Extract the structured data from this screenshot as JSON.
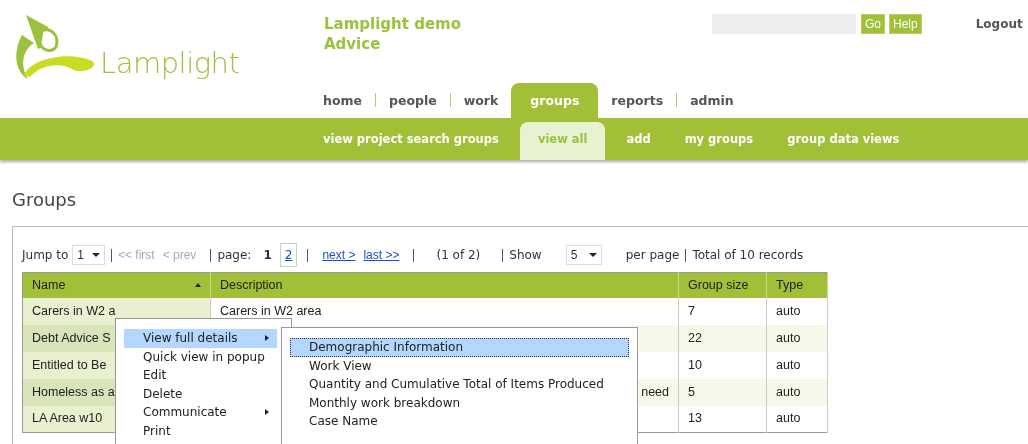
{
  "header": {
    "title_lines": [
      "Lamplight demo",
      "Advice"
    ],
    "logo_text": "Lamplight",
    "search_buttons": [
      "Go",
      "Help"
    ],
    "logout": "Logout"
  },
  "main_nav": [
    {
      "label": "home",
      "selected": false
    },
    {
      "label": "people",
      "selected": false
    },
    {
      "label": "work",
      "selected": false
    },
    {
      "label": "groups",
      "selected": true
    },
    {
      "label": "reports",
      "selected": false
    },
    {
      "label": "admin",
      "selected": false
    }
  ],
  "sub_nav": [
    {
      "label": "view project search groups",
      "selected": false
    },
    {
      "label": "view all",
      "selected": true
    },
    {
      "label": "add",
      "selected": false
    },
    {
      "label": "my groups",
      "selected": false
    },
    {
      "label": "group data views",
      "selected": false
    }
  ],
  "page_title": "Groups",
  "pager": {
    "jump_label": "Jump to",
    "jump_value": "1",
    "first": "<< first",
    "prev": "< prev",
    "page_label": "page:",
    "pages": [
      {
        "label": "1",
        "selected": true
      },
      {
        "label": "2",
        "selected": false
      }
    ],
    "next": "next >",
    "last": "last >>",
    "count": "(1 of 2)",
    "show_label": "Show",
    "show_value": "5",
    "per_page": "per page",
    "total": "Total of 10 records"
  },
  "table": {
    "columns": [
      {
        "label": "Name",
        "sorted": true
      },
      {
        "label": "Description",
        "sorted": false
      },
      {
        "label": "Group size",
        "sorted": false
      },
      {
        "label": "Type",
        "sorted": false
      }
    ],
    "rows": [
      {
        "cells": [
          "Carers in W2 a",
          "Carers in W2 area",
          "7",
          "auto"
        ]
      },
      {
        "cells": [
          "Debt Advice S",
          "",
          "22",
          "auto"
        ]
      },
      {
        "cells": [
          "Entitled to Be",
          "",
          "10",
          "auto"
        ]
      },
      {
        "cells": [
          "Homeless as a",
          "need",
          "5",
          "auto"
        ]
      },
      {
        "cells": [
          "LA Area w10",
          "",
          "13",
          "auto"
        ]
      }
    ]
  },
  "context_menu": {
    "items": [
      {
        "label": "View full details",
        "selected": true,
        "submenu": true
      },
      {
        "label": "Quick view in popup",
        "selected": false,
        "submenu": false
      },
      {
        "label": "Edit",
        "selected": false,
        "submenu": false
      },
      {
        "label": "Delete",
        "selected": false,
        "submenu": false
      },
      {
        "label": "Communicate",
        "selected": false,
        "submenu": true
      },
      {
        "label": "Print",
        "selected": false,
        "submenu": false
      }
    ]
  },
  "submenu": {
    "items": [
      {
        "label": "Demographic Information",
        "selected": true
      },
      {
        "label": "Work View",
        "selected": false
      },
      {
        "label": "Quantity and Cumulative Total of Items Produced",
        "selected": false
      },
      {
        "label": "Monthly work breakdown",
        "selected": false
      },
      {
        "label": "Case Name",
        "selected": false
      }
    ]
  }
}
